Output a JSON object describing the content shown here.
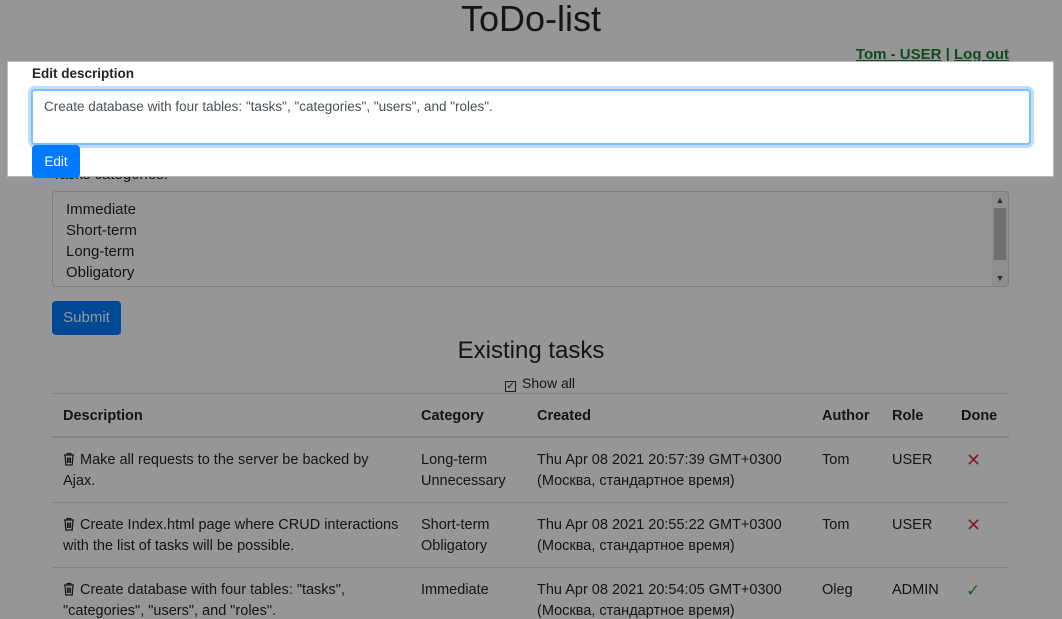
{
  "header": {
    "title": "ToDo-list",
    "user_label": "Tom - USER",
    "separator": "|",
    "logout_label": "Log out"
  },
  "new_task_form": {
    "categories_label": "Tasks categories:",
    "categories": [
      "Immediate",
      "Short-term",
      "Long-term",
      "Obligatory"
    ],
    "submit_label": "Submit"
  },
  "tasks_section": {
    "title": "Existing tasks",
    "show_all_label": "Show all",
    "columns": [
      "Description",
      "Category",
      "Created",
      "Author",
      "Role",
      "Done"
    ],
    "rows": [
      {
        "description": "Make all requests to the server be backed by Ajax.",
        "categories": [
          "Long-term",
          "Unnecessary"
        ],
        "created_line1": "Thu Apr 08 2021 20:57:39 GMT+0300",
        "created_line2": "(Москва, стандартное время)",
        "author": "Tom",
        "role": "USER",
        "done": "✕",
        "done_state": "not-done"
      },
      {
        "description": "Create Index.html page where CRUD interactions with the list of tasks will be possible.",
        "categories": [
          "Short-term",
          "Obligatory"
        ],
        "created_line1": "Thu Apr 08 2021 20:55:22 GMT+0300",
        "created_line2": "(Москва, стандартное время)",
        "author": "Tom",
        "role": "USER",
        "done": "✕",
        "done_state": "not-done"
      },
      {
        "description": "Create database with four tables: \"tasks\", \"categories\", \"users\", and \"roles\".",
        "categories": [
          "Immediate"
        ],
        "created_line1": "Thu Apr 08 2021 20:54:05 GMT+0300",
        "created_line2": "(Москва, стандартное время)",
        "author": "Oleg",
        "role": "ADMIN",
        "done": "✓",
        "done_state": "done"
      }
    ]
  },
  "edit_modal": {
    "label": "Edit description",
    "value": "Create database with four tables: \"tasks\", \"categories\", \"users\", and \"roles\".",
    "button_label": "Edit"
  },
  "colors": {
    "primary": "#007bff",
    "danger": "#dc3545",
    "success": "#28a745",
    "user_link": "#1e7e34"
  }
}
